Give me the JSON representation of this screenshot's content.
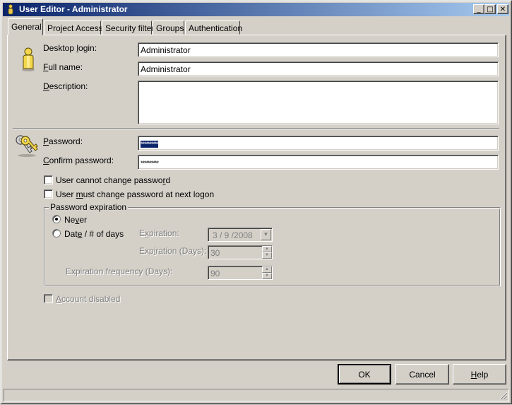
{
  "window": {
    "title": "User Editor - Administrator",
    "min_glyph": "_",
    "max_glyph": "□",
    "close_glyph": "✕"
  },
  "tabs": [
    {
      "label": "General",
      "active": true
    },
    {
      "label": "Project Access",
      "active": false
    },
    {
      "label": "Security filter",
      "active": false
    },
    {
      "label": "Groups",
      "active": false
    },
    {
      "label": "Authentication",
      "active": false
    }
  ],
  "general": {
    "desktop_login": {
      "label_pre": "Desktop ",
      "label_u": "l",
      "label_post": "ogin:",
      "value": "Administrator"
    },
    "full_name": {
      "label_pre": "",
      "label_u": "F",
      "label_post": "ull name:",
      "value": "Administrator"
    },
    "description": {
      "label_pre": "",
      "label_u": "D",
      "label_post": "escription:",
      "value": ""
    },
    "password": {
      "label_pre": "",
      "label_u": "P",
      "label_post": "assword:",
      "value": "**********"
    },
    "confirm_password": {
      "label_pre": "",
      "label_u": "C",
      "label_post": "onfirm password:",
      "value": "**********"
    },
    "cannot_change": {
      "label_pre": "User cannot change passwo",
      "label_u": "r",
      "label_post": "d",
      "checked": false
    },
    "must_change": {
      "label_pre": "User ",
      "label_u": "m",
      "label_post": "ust change password at next logon",
      "checked": false
    },
    "expiration": {
      "legend": "Password expiration",
      "never": {
        "label_pre": "Ne",
        "label_u": "v",
        "label_post": "er",
        "checked": true
      },
      "date": {
        "label_pre": "Dat",
        "label_u": "e",
        "label_post": " / # of days",
        "checked": false
      },
      "expiration_label": {
        "label_pre": "E",
        "label_u": "x",
        "label_post": "piration:"
      },
      "expiration_value": "3 / 9 /2008",
      "days_label": {
        "label_pre": "Exp",
        "label_u": "i",
        "label_post": "ration (Days):"
      },
      "days_value": "30",
      "frequency_label": "Expiration frequency (Days):",
      "frequency_value": "90"
    },
    "account_disabled": {
      "label_pre": "",
      "label_u": "A",
      "label_post": "ccount disabled",
      "checked": false
    }
  },
  "buttons": {
    "ok": "OK",
    "cancel": "Cancel",
    "help_u": "H",
    "help_post": "elp"
  },
  "icons": {
    "title": "user-icon",
    "user": "user-icon",
    "keys": "keys-icon",
    "spin_up": "spin-up-icon",
    "spin_down": "spin-down-icon",
    "dropdown": "chevron-down-icon"
  },
  "spin": {
    "up": "▲",
    "down": "▼",
    "drop": "▼"
  }
}
